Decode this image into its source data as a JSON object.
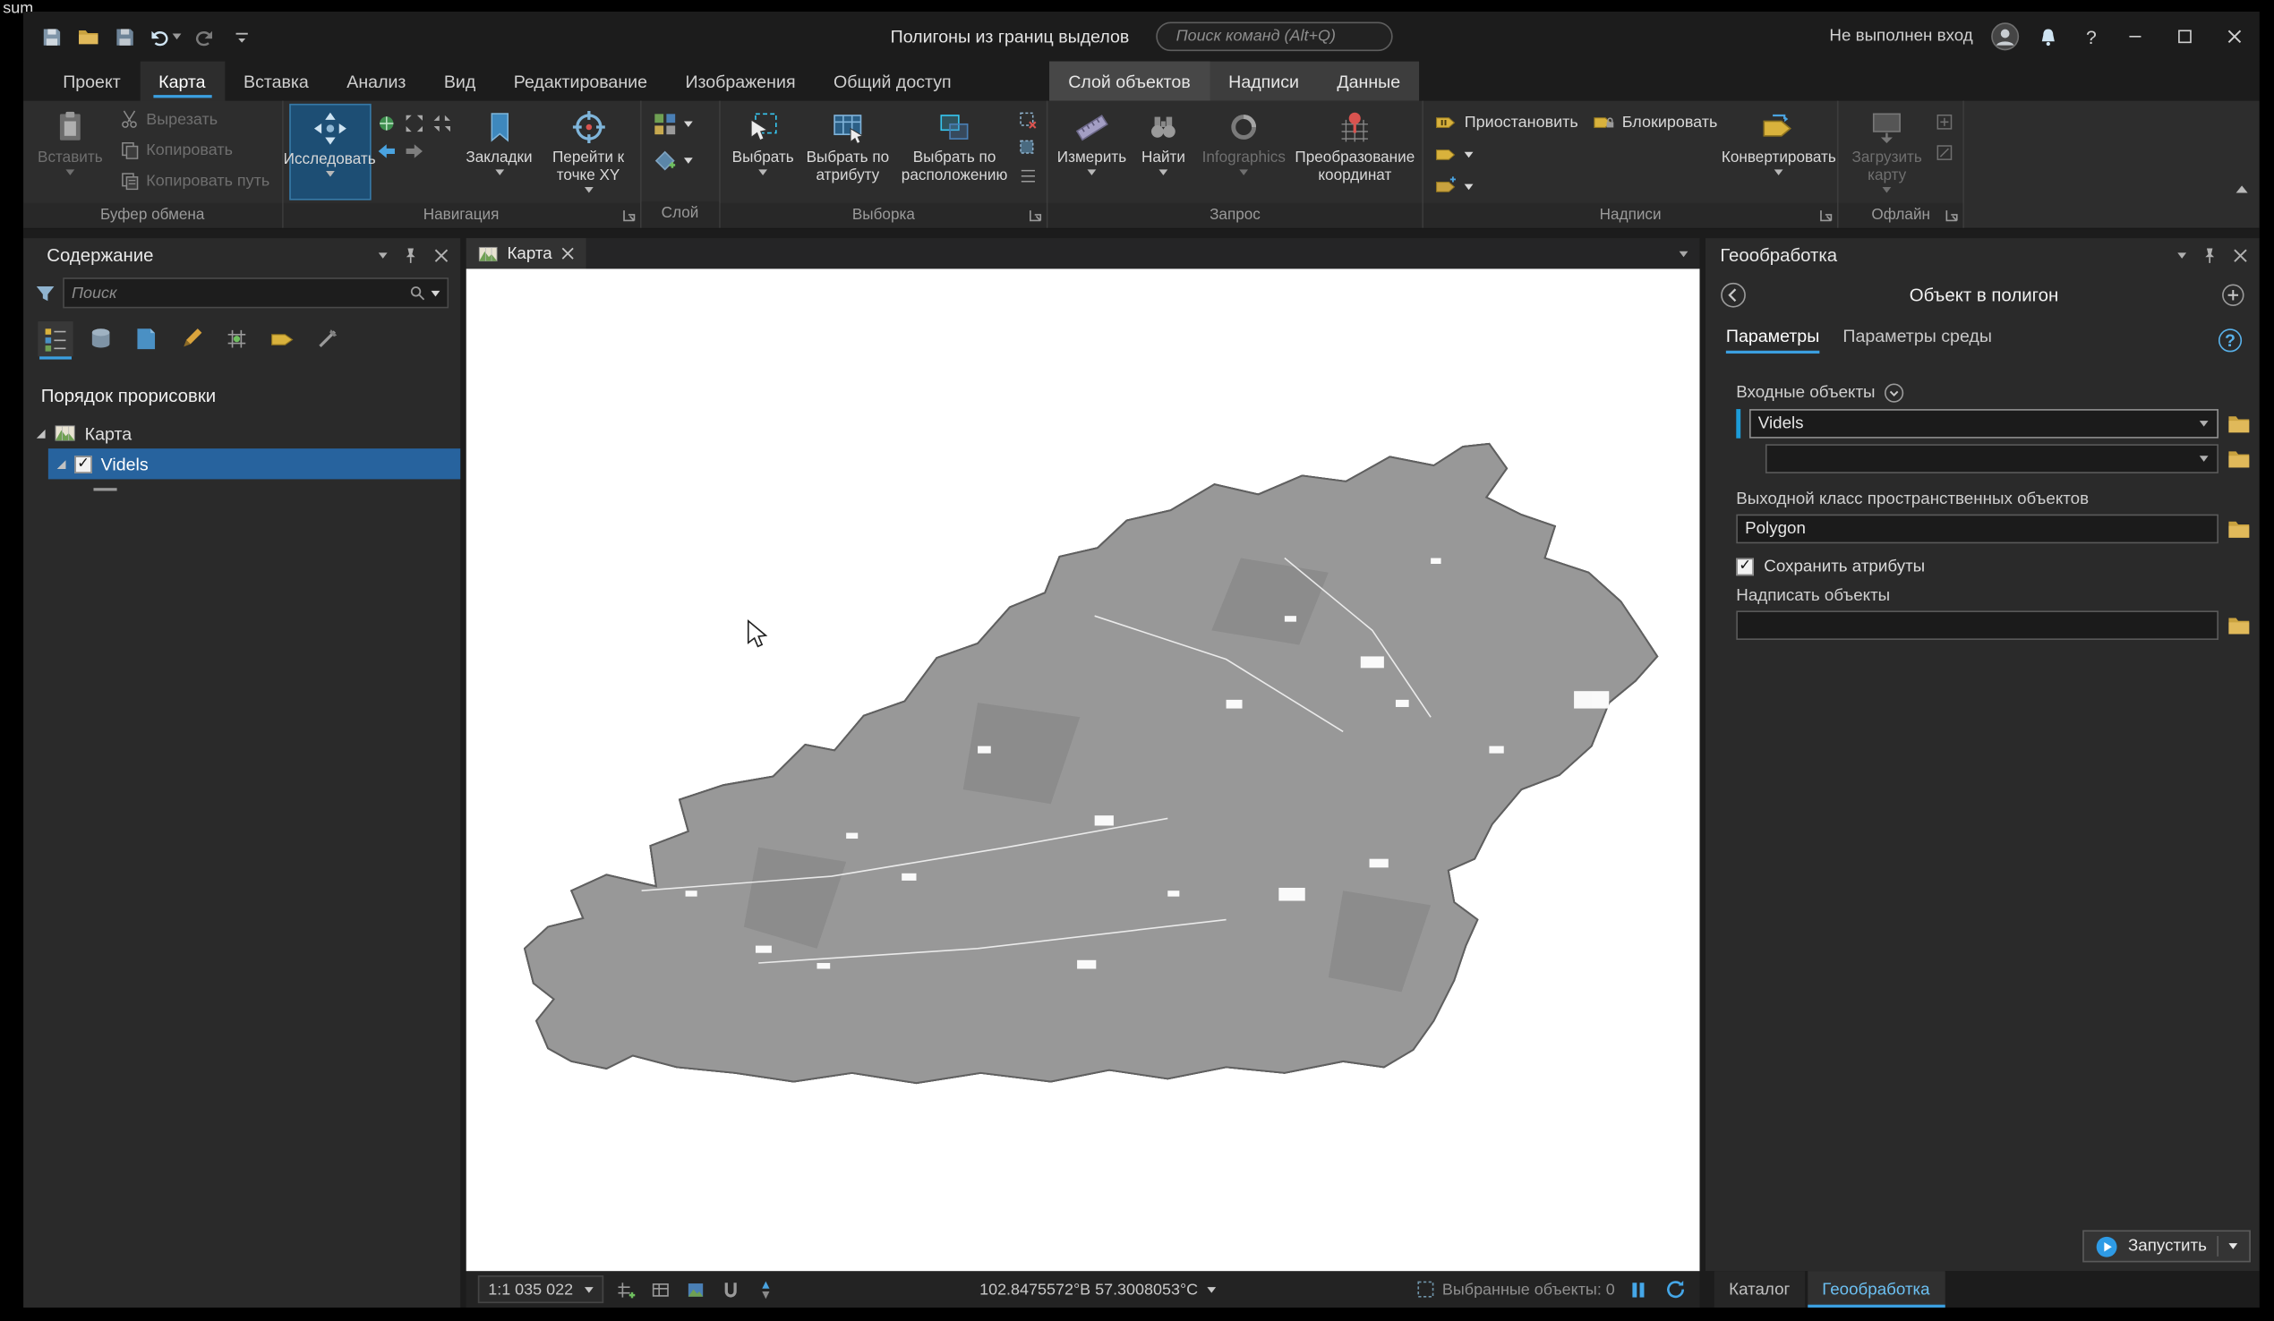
{
  "page": {
    "corner_text": "sum"
  },
  "glyphs": {
    "help": "?"
  },
  "titlebar": {
    "project_title": "Полигоны из границ выделов",
    "search_placeholder": "Поиск команд (Alt+Q)",
    "sign_in_status": "Не выполнен вход"
  },
  "ribbon": {
    "tabs": [
      "Проект",
      "Карта",
      "Вставка",
      "Анализ",
      "Вид",
      "Редактирование",
      "Изображения",
      "Общий доступ"
    ],
    "active_tab": "Карта",
    "contextual_tabs": [
      "Слой объектов",
      "Надписи",
      "Данные"
    ],
    "groups": {
      "clipboard": {
        "label": "Буфер обмена",
        "paste": "Вставить",
        "cut": "Вырезать",
        "copy": "Копировать",
        "copy_path": "Копировать путь"
      },
      "navigation": {
        "label": "Навигация",
        "explore": "Исследовать",
        "bookmarks": "Закладки",
        "goto_xy": "Перейти к точке XY"
      },
      "layer": {
        "label": "Слой"
      },
      "selection": {
        "label": "Выборка",
        "select": "Выбрать",
        "by_attribute": "Выбрать по атрибуту",
        "by_location": "Выбрать по расположению"
      },
      "inquiry": {
        "label": "Запрос",
        "measure": "Измерить",
        "locate": "Найти",
        "infographics": "Infographics",
        "coordinate_conversion": "Преобразование координат"
      },
      "labeling": {
        "label": "Надписи",
        "pause": "Приостановить",
        "lock": "Блокировать",
        "convert": "Конвертировать"
      },
      "offline": {
        "label": "Офлайн",
        "download_map": "Загрузить карту"
      }
    }
  },
  "contents": {
    "title": "Содержание",
    "search_placeholder": "Поиск",
    "section": "Порядок прорисовки",
    "map_item": "Карта",
    "layer_item": "Videls"
  },
  "map": {
    "tab": "Карта",
    "scale": "1:1 035 022",
    "coordinates": "102.8475572°В 57.3008053°С",
    "selected_features": "Выбранные объекты: 0"
  },
  "geoprocessing": {
    "panel_title": "Геообработка",
    "tool_title": "Объект в полигон",
    "tab_parameters": "Параметры",
    "tab_environment": "Параметры среды",
    "input_label": "Входные объекты",
    "input_value": "Videls",
    "output_label": "Выходной класс пространственных объектов",
    "output_value": "Polygon",
    "keep_attributes": "Сохранить атрибуты",
    "label_features": "Надписать объекты",
    "run": "Запустить",
    "bottom_tab_catalog": "Каталог",
    "bottom_tab_geoprocessing": "Геообработка"
  },
  "colors": {
    "accent": "#3b9fe0",
    "selection_row": "#27639e",
    "map_feature_fill": "#989898",
    "map_feature_outline": "#6e6e6e"
  }
}
